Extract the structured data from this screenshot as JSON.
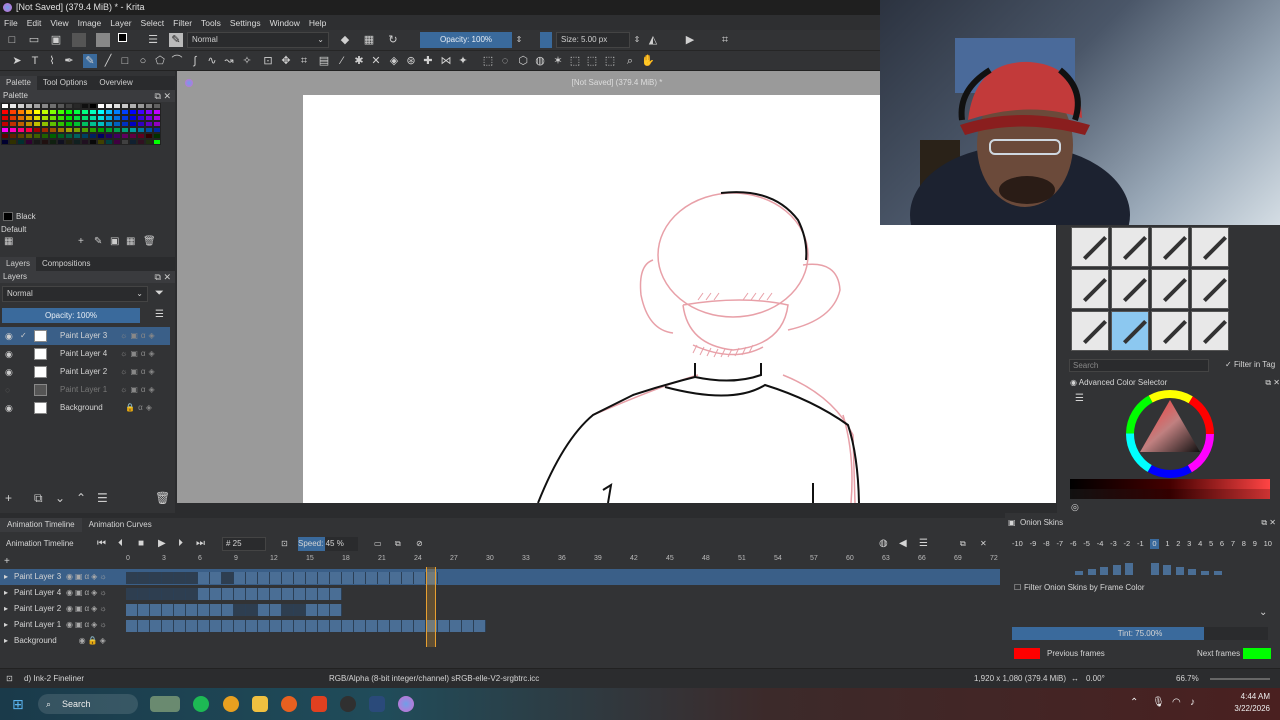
{
  "window": {
    "title": "[Not Saved]  (379.4 MiB) * - Krita"
  },
  "menu": [
    "File",
    "Edit",
    "View",
    "Image",
    "Layer",
    "Select",
    "Filter",
    "Tools",
    "Settings",
    "Window",
    "Help"
  ],
  "toolbar": {
    "blend_mode": "Normal",
    "opacity_label": "Opacity: 100%",
    "size_label": "Size: 5.00 px"
  },
  "canvas": {
    "title": "[Not Saved]  (379.4 MiB) *"
  },
  "left_tabs": [
    "Palette",
    "Tool Options",
    "Overview"
  ],
  "palette": {
    "header": "Palette",
    "current_color_name": "Black",
    "palette_name": "Default",
    "swatches": [
      "#ffffff",
      "#e8e8e8",
      "#d0d0d0",
      "#b8b8b8",
      "#a0a0a0",
      "#888888",
      "#707070",
      "#585858",
      "#404040",
      "#282828",
      "#101010",
      "#000000",
      "#ffffff",
      "#f0f0f0",
      "#e0e0e0",
      "#c8c8c8",
      "#b0b0b0",
      "#989898",
      "#808080",
      "#606060",
      "#ff0000",
      "#ff4000",
      "#ff8000",
      "#ffbf00",
      "#ffff00",
      "#bfff00",
      "#80ff00",
      "#40ff00",
      "#00ff00",
      "#00ff40",
      "#00ff80",
      "#00ffbf",
      "#00ffff",
      "#00bfff",
      "#0080ff",
      "#0040ff",
      "#0000ff",
      "#4000ff",
      "#8000ff",
      "#bf00ff",
      "#e00000",
      "#e03800",
      "#e07000",
      "#e0a800",
      "#e0e000",
      "#a8e000",
      "#70e000",
      "#38e000",
      "#00e000",
      "#00e038",
      "#00e070",
      "#00e0a8",
      "#00e0e0",
      "#00a8e0",
      "#0070e0",
      "#0038e0",
      "#0000e0",
      "#3800e0",
      "#7000e0",
      "#a800e0",
      "#c00000",
      "#c03000",
      "#c06000",
      "#c09000",
      "#c0c000",
      "#90c000",
      "#60c000",
      "#30c000",
      "#00c000",
      "#00c030",
      "#00c060",
      "#00c090",
      "#00c0c0",
      "#0090c0",
      "#0060c0",
      "#0030c0",
      "#0000c0",
      "#3000c0",
      "#6000c0",
      "#9000c0",
      "#ff00ff",
      "#ff00bf",
      "#ff0080",
      "#ff0040",
      "#a00000",
      "#a02800",
      "#a05000",
      "#a07800",
      "#a0a000",
      "#78a000",
      "#50a000",
      "#28a000",
      "#00a000",
      "#00a028",
      "#00a050",
      "#00a078",
      "#00a0a0",
      "#0078a0",
      "#0050a0",
      "#0028a0",
      "#600000",
      "#602000",
      "#604000",
      "#606000",
      "#406000",
      "#206000",
      "#006000",
      "#006020",
      "#006040",
      "#006060",
      "#004060",
      "#002060",
      "#000060",
      "#200060",
      "#400060",
      "#600060",
      "#600040",
      "#600020",
      "#300000",
      "#003000",
      "#000030",
      "#303000",
      "#003030",
      "#300030",
      "#181818",
      "#201010",
      "#102010",
      "#101020",
      "#202010",
      "#102020",
      "#201020",
      "#080808",
      "#404000",
      "#004040",
      "#400040",
      "#404040",
      "#102030",
      "#301020",
      "#203010",
      "#00ff00"
    ]
  },
  "layers_panel": {
    "tabs": [
      "Layers",
      "Compositions"
    ],
    "header": "Layers",
    "blend_mode": "Normal",
    "opacity_label": "Opacity:  100%",
    "layers": [
      {
        "name": "Paint Layer 3",
        "visible": true,
        "active": true
      },
      {
        "name": "Paint Layer 4",
        "visible": true,
        "active": false
      },
      {
        "name": "Paint Layer 2",
        "visible": true,
        "active": false
      },
      {
        "name": "Paint Layer 1",
        "visible": false,
        "active": false
      },
      {
        "name": "Background",
        "visible": true,
        "active": false
      }
    ]
  },
  "right_panel": {
    "search_placeholder": "Search",
    "filter_label": "Filter in Tag",
    "color_selector_title": "Advanced Color Selector"
  },
  "timeline": {
    "tabs": [
      "Animation Timeline",
      "Animation Curves"
    ],
    "header": "Animation Timeline",
    "frame_value": "25",
    "speed_label": "Speed: 45 %",
    "frame_ticks": [
      "0",
      "3",
      "6",
      "9",
      "12",
      "15",
      "18",
      "21",
      "24",
      "27",
      "30",
      "33",
      "36",
      "39",
      "42",
      "45",
      "48",
      "51",
      "54",
      "57",
      "60",
      "63",
      "66",
      "69",
      "72"
    ],
    "current_frame": 25,
    "tracks": [
      {
        "name": "Paint Layer 3"
      },
      {
        "name": "Paint Layer 4"
      },
      {
        "name": "Paint Layer 2"
      },
      {
        "name": "Paint Layer 1"
      },
      {
        "name": "Background"
      }
    ]
  },
  "onion_skins": {
    "header": "Onion Skins",
    "numbers": [
      "-10",
      "-9",
      "-8",
      "-7",
      "-6",
      "-5",
      "-4",
      "-3",
      "-2",
      "-1",
      "0",
      "1",
      "2",
      "3",
      "4",
      "5",
      "6",
      "7",
      "8",
      "9",
      "10"
    ],
    "filter_label": "Filter Onion Skins by Frame Color",
    "tint_label": "Tint: 75.00%",
    "tint_value": 0.75,
    "previous_label": "Previous frames",
    "next_label": "Next frames",
    "previous_color": "#ff0000",
    "next_color": "#00ff00"
  },
  "status": {
    "brush": "d) Ink-2 Fineliner",
    "colorspace": "RGB/Alpha (8-bit integer/channel)  sRGB-elle-V2-srgbtrc.icc",
    "dimensions": "1,920 x 1,080 (379.4 MiB)",
    "rotation": "0.00°",
    "zoom": "66.7%"
  },
  "taskbar": {
    "search_label": "Search",
    "time": "4:44 AM",
    "date": "3/22/2026"
  }
}
